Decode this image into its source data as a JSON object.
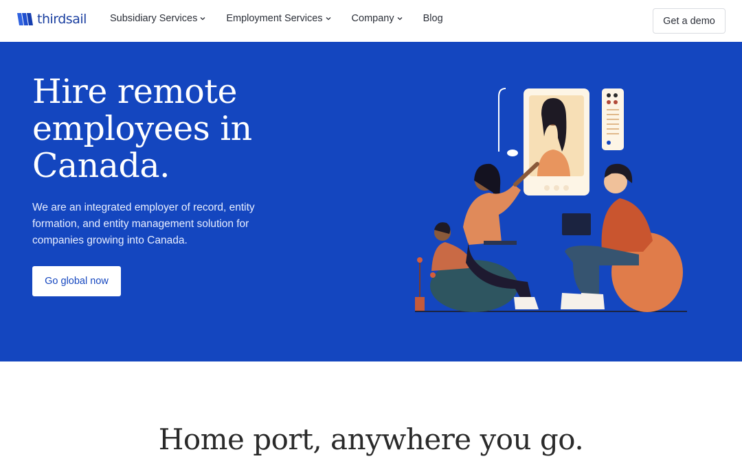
{
  "nav": {
    "brand": "thirdsail",
    "items": [
      {
        "label": "Subsidiary Services",
        "dropdown": true
      },
      {
        "label": "Employment Services",
        "dropdown": true
      },
      {
        "label": "Company",
        "dropdown": true
      },
      {
        "label": "Blog",
        "dropdown": false
      }
    ],
    "cta": "Get a demo"
  },
  "hero": {
    "title": "Hire remote employees in Canada.",
    "subtitle": "We are an integrated employer of record, entity formation, and entity management solution for companies growing into Canada.",
    "cta": "Go global now",
    "illustration": "video-call-illustration"
  },
  "section2": {
    "title": "Home port, anywhere you go."
  },
  "colors": {
    "brand_blue": "#1446bf",
    "white": "#ffffff",
    "text_dark": "#2b2f38"
  },
  "icons": [
    "thirdsail-logo-icon",
    "chevron-down-icon"
  ]
}
